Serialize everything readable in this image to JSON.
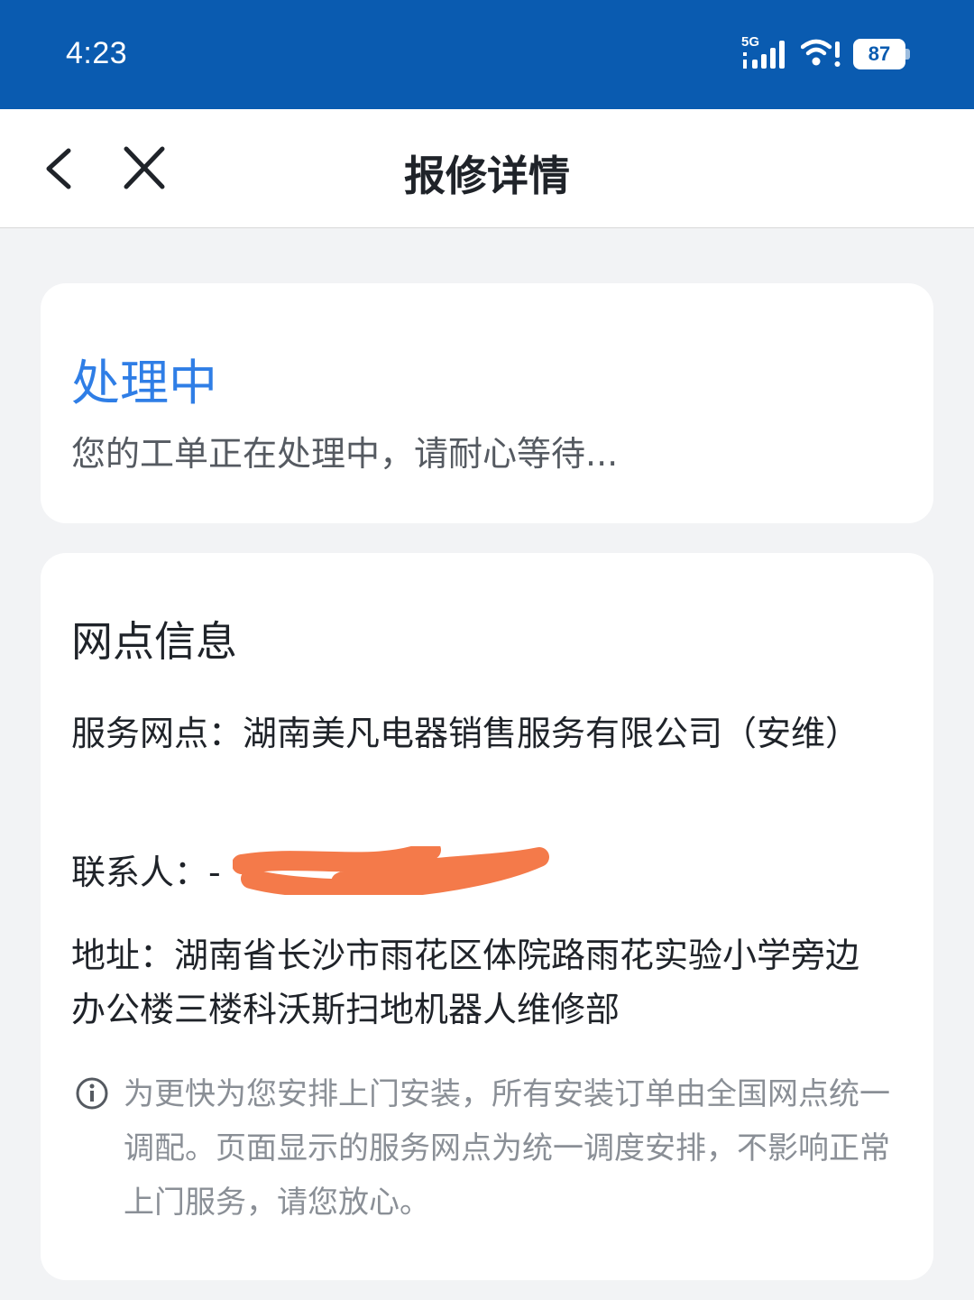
{
  "status_bar": {
    "time": "4:23",
    "network": "5G",
    "battery": "87",
    "icons": [
      "signal-icon",
      "wifi-icon",
      "battery-icon"
    ]
  },
  "nav": {
    "title": "报修详情",
    "back_icon": "chevron-left-icon",
    "close_icon": "close-icon"
  },
  "status_card": {
    "title": "处理中",
    "description": "您的工单正在处理中，请耐心等待..."
  },
  "info_card": {
    "heading": "网点信息",
    "outlet_label": "服务网点：",
    "outlet_value": "湖南美凡电器销售服务有限公司（安维）",
    "contact_label": "联系人：",
    "contact_value": "-",
    "address_label": "地址：",
    "address_value": "湖南省长沙市雨花区体院路雨花实验小学旁边办公楼三楼科沃斯扫地机器人维修部",
    "notice_icon": "info-icon",
    "notice": "为更快为您安排上门安装，所有安装订单由全国网点统一调配。页面显示的服务网点为统一调度安排，不影响正常上门服务，请您放心。"
  },
  "colors": {
    "status_bar": "#0a5bb0",
    "accent": "#2f7ee6",
    "background": "#f2f3f5",
    "redaction": "#f47a4a"
  }
}
